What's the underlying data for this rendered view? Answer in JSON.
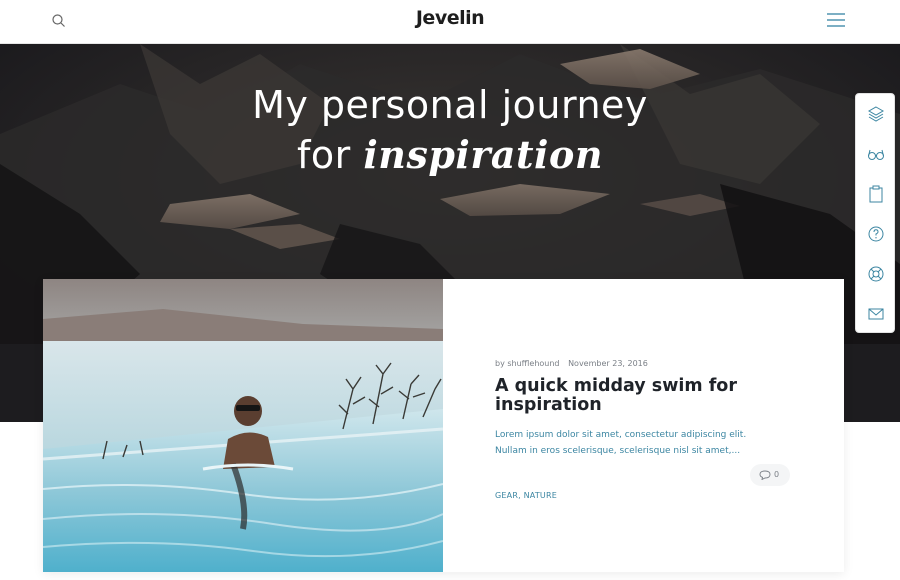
{
  "header": {
    "logo": "Jevelin",
    "search_icon": "search-icon",
    "menu_icon": "hamburger-menu-icon"
  },
  "hero": {
    "title_line1": "My personal journey",
    "title_line2_plain": "for",
    "title_line2_emphasis": "inspiration"
  },
  "toolbar": {
    "items": [
      {
        "icon": "layers-icon"
      },
      {
        "icon": "glasses-icon"
      },
      {
        "icon": "clipboard-icon"
      },
      {
        "icon": "help-circle-icon"
      },
      {
        "icon": "lifebuoy-icon"
      },
      {
        "icon": "envelope-icon"
      }
    ]
  },
  "post": {
    "author": "by shufflehound",
    "date": "November 23, 2016",
    "title": "A quick midday swim for inspiration",
    "excerpt_line1": "Lorem ipsum dolor sit amet, consectetur adipiscing elit.",
    "excerpt_line2": "Nullam in eros scelerisque, scelerisque nisl sit amet,...",
    "comment_count": "0",
    "tags": [
      "GEAR",
      "NATURE"
    ]
  },
  "colors": {
    "accent": "#3c86a2",
    "hero_bg": "#1d1c1f",
    "text_dark": "#1f2329"
  }
}
